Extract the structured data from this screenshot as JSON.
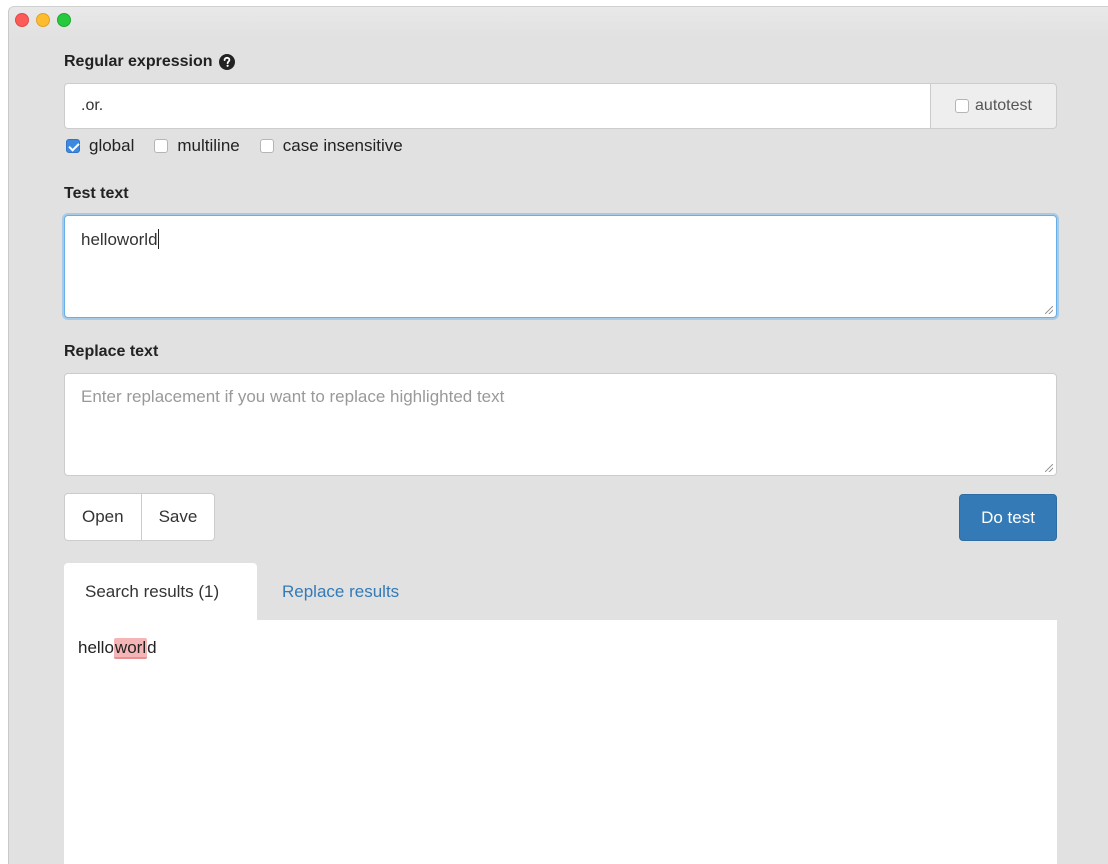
{
  "window": {
    "traffic_lights": [
      "close",
      "minimize",
      "maximize"
    ]
  },
  "regex": {
    "label": "Regular expression",
    "help_icon": "question-circle-icon",
    "value": ".or.",
    "autotest_label": "autotest",
    "autotest_checked": false
  },
  "flags": [
    {
      "label": "global",
      "checked": true
    },
    {
      "label": "multiline",
      "checked": false
    },
    {
      "label": "case insensitive",
      "checked": false
    }
  ],
  "test_text": {
    "label": "Test text",
    "value": "helloworld"
  },
  "replace_text": {
    "label": "Replace text",
    "placeholder": "Enter replacement if you want to replace highlighted text",
    "value": ""
  },
  "buttons": {
    "open": "Open",
    "save": "Save",
    "do_test": "Do test"
  },
  "tabs": [
    {
      "label": "Search results (1)",
      "active": true
    },
    {
      "label": "Replace results",
      "active": false
    }
  ],
  "results": {
    "before_match": "hello",
    "match": "worl",
    "after_match": "d"
  },
  "colors": {
    "accent": "#337ab7",
    "focus_border": "#66afe9",
    "match_highlight": "#f5b5b7",
    "checkbox_checked": "#3e88e0"
  }
}
